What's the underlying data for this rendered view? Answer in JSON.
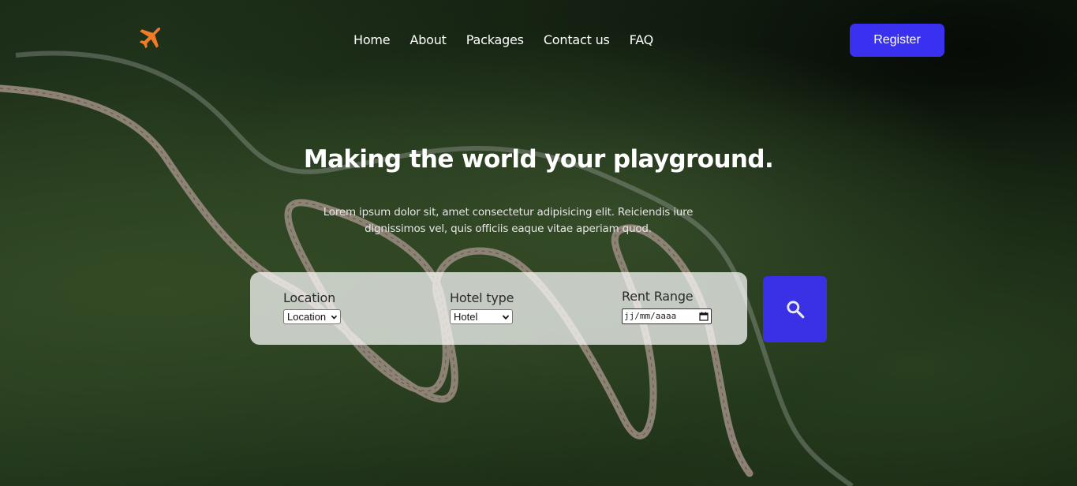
{
  "nav": {
    "logo_icon": "airplane-icon",
    "links": [
      "Home",
      "About",
      "Packages",
      "Contact us",
      "FAQ"
    ],
    "register_label": "Register"
  },
  "hero": {
    "title": "Making the world your playground.",
    "subtitle": "Lorem ipsum dolor sit, amet consectetur adipisicing elit. Reiciendis iure dignissimos vel, quis officiis eaque vitae aperiam quod."
  },
  "search": {
    "location": {
      "label": "Location",
      "selected": "Location"
    },
    "hotel_type": {
      "label": "Hotel type",
      "selected": "Hotel"
    },
    "rent_range": {
      "label": "Rent Range",
      "placeholder": "jj/mm/aaaa"
    },
    "button_icon": "search-icon"
  },
  "colors": {
    "accent": "#3a31f0",
    "logo": "#f07c28"
  }
}
